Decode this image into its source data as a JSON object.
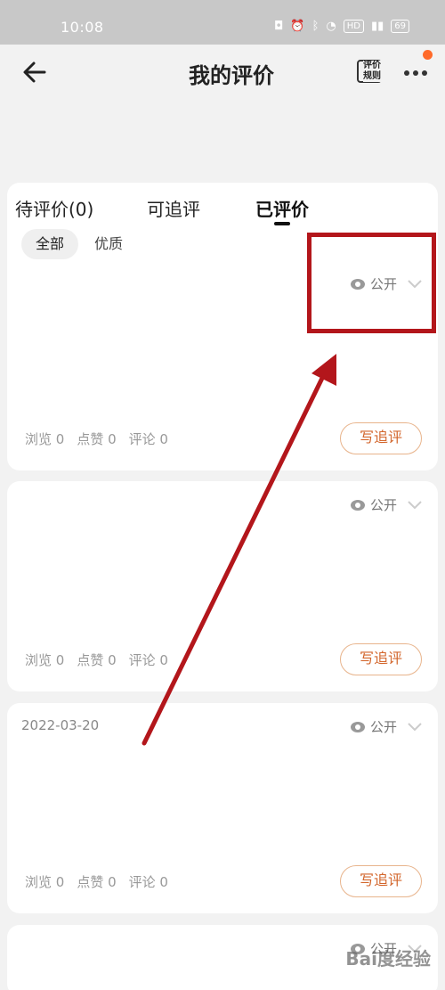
{
  "status_bar": {
    "time": "10:08",
    "network_badge": "HD",
    "battery": "69"
  },
  "header": {
    "title": "我的评价",
    "rules_label": "评价规则"
  },
  "tabs": [
    {
      "label": "待评价(0)",
      "active": false
    },
    {
      "label": "可追评",
      "active": false
    },
    {
      "label": "已评价",
      "active": true
    }
  ],
  "filters": [
    {
      "label": "全部",
      "active": true
    },
    {
      "label": "优质",
      "active": false
    }
  ],
  "reviews": [
    {
      "date": "",
      "visibility": "公开",
      "stats": {
        "views": "浏览 0",
        "likes": "点赞 0",
        "comments": "评论 0"
      },
      "action_label": "写追评"
    },
    {
      "date": "",
      "visibility": "公开",
      "stats": {
        "views": "浏览 0",
        "likes": "点赞 0",
        "comments": "评论 0"
      },
      "action_label": "写追评"
    },
    {
      "date": "2022-03-20",
      "visibility": "公开",
      "stats": {
        "views": "浏览 0",
        "likes": "点赞 0",
        "comments": "评论 0"
      },
      "action_label": "写追评"
    },
    {
      "date": "",
      "visibility": "公开"
    }
  ],
  "watermark": "Bai度经验",
  "colors": {
    "accent": "#d3662c",
    "annotation_red": "#b3161b",
    "badge": "#ff6a2a"
  }
}
